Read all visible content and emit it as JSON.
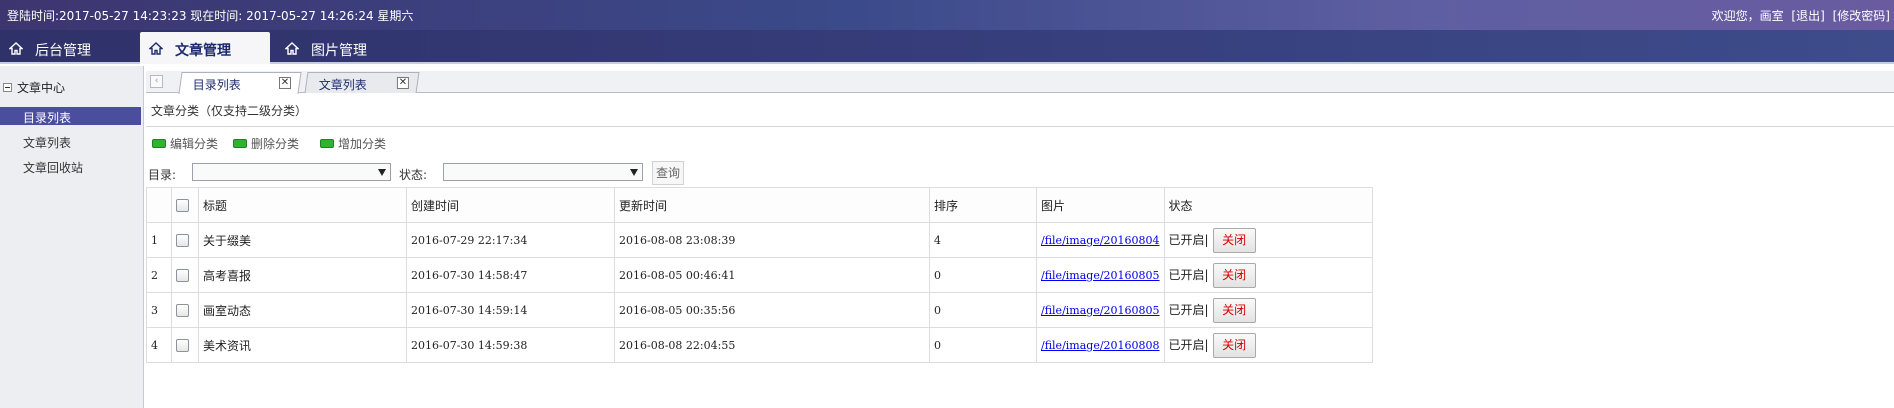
{
  "header": {
    "login_info": "登陆时间:2017-05-27 14:23:23 现在时间:  2017-05-27 14:26:24 星期六",
    "welcome": "欢迎您，画室",
    "logout": "[退出]",
    "change_password": "[修改密码]"
  },
  "nav": {
    "tabs": [
      {
        "label": "后台管理",
        "icon": "home-icon"
      },
      {
        "label": "文章管理",
        "icon": "home-icon",
        "active": true
      },
      {
        "label": "图片管理",
        "icon": "home-icon"
      }
    ]
  },
  "sidebar": {
    "section": "文章中心",
    "items": [
      {
        "label": "目录列表",
        "active": true
      },
      {
        "label": "文章列表"
      },
      {
        "label": "文章回收站"
      }
    ]
  },
  "page_tabs": [
    {
      "label": "目录列表",
      "active": true,
      "close": "✕"
    },
    {
      "label": "文章列表",
      "close": "✕"
    }
  ],
  "main": {
    "title": "文章分类（仅支持二级分类）",
    "actions": [
      {
        "label": "编辑分类",
        "icon": "edit-icon"
      },
      {
        "label": "删除分类",
        "icon": "delete-icon"
      },
      {
        "label": "增加分类",
        "icon": "add-icon"
      }
    ],
    "filter": {
      "directory_label": "目录:",
      "directory_value": "",
      "status_label": "状态:",
      "status_value": "",
      "query_label": "查询"
    },
    "table": {
      "headers": [
        "",
        "",
        "标题",
        "创建时间",
        "更新时间",
        "排序",
        "图片",
        "状态"
      ],
      "rows": [
        {
          "index": "1",
          "title": "关于缀美",
          "created": "2016-07-29 22:17:34",
          "updated": "2016-08-08 23:08:39",
          "sort": "4",
          "image": "/file/image/20160804",
          "status": "已开启|",
          "action": "关闭"
        },
        {
          "index": "2",
          "title": "高考喜报",
          "created": "2016-07-30 14:58:47",
          "updated": "2016-08-05 00:46:41",
          "sort": "0",
          "image": "/file/image/20160805",
          "status": "已开启|",
          "action": "关闭"
        },
        {
          "index": "3",
          "title": "画室动态",
          "created": "2016-07-30 14:59:14",
          "updated": "2016-08-05 00:35:56",
          "sort": "0",
          "image": "/file/image/20160805",
          "status": "已开启|",
          "action": "关闭"
        },
        {
          "index": "4",
          "title": "美术资讯",
          "created": "2016-07-30 14:59:38",
          "updated": "2016-08-08 22:04:55",
          "sort": "0",
          "image": "/file/image/20160808",
          "status": "已开启|",
          "action": "关闭"
        }
      ]
    }
  },
  "colors": {
    "header_bg": "#3b4a8a",
    "active_sidebar": "#4a4e9c",
    "close_text": "#d40000",
    "link": "#0000ee"
  }
}
